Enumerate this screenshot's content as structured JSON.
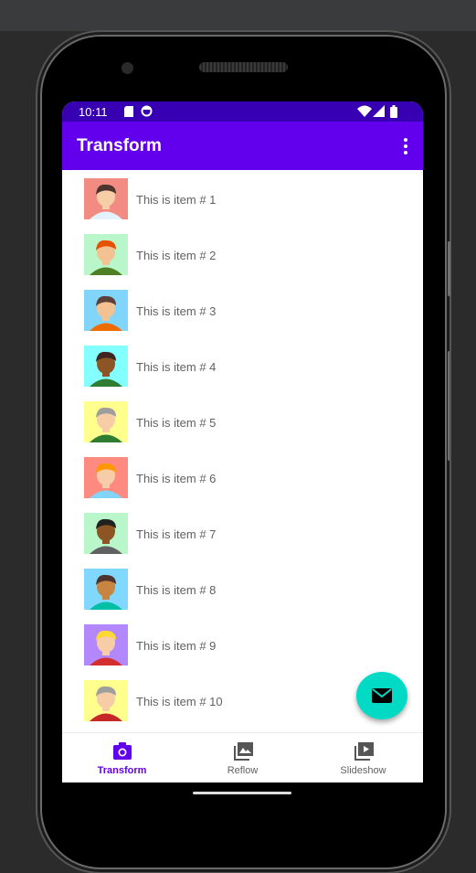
{
  "status_bar": {
    "time": "10:11"
  },
  "app_bar": {
    "title": "Transform"
  },
  "list": {
    "items": [
      {
        "label": "This is item # 1",
        "bg": "#f28b82",
        "skin": "#f7cda8",
        "hair": "#4e342e",
        "shirt": "#e3f2fd"
      },
      {
        "label": "This is item # 2",
        "bg": "#b9f6ca",
        "skin": "#f4c292",
        "hair": "#e65100",
        "shirt": "#4e7f24"
      },
      {
        "label": "This is item # 3",
        "bg": "#81d4fa",
        "skin": "#f4c292",
        "hair": "#5d4037",
        "shirt": "#ef6c00"
      },
      {
        "label": "This is item # 4",
        "bg": "#84ffff",
        "skin": "#8d5524",
        "hair": "#3e2723",
        "shirt": "#2e7d32"
      },
      {
        "label": "This is item # 5",
        "bg": "#ffff8d",
        "skin": "#f7cda8",
        "hair": "#9e9e9e",
        "shirt": "#2e7d32"
      },
      {
        "label": "This is item # 6",
        "bg": "#ff8a80",
        "skin": "#f7cda8",
        "hair": "#ff9800",
        "shirt": "#81d4fa"
      },
      {
        "label": "This is item # 7",
        "bg": "#b9f6ca",
        "skin": "#8d5524",
        "hair": "#212121",
        "shirt": "#616161"
      },
      {
        "label": "This is item # 8",
        "bg": "#80d8ff",
        "skin": "#c68642",
        "hair": "#4e342e",
        "shirt": "#00bfa5"
      },
      {
        "label": "This is item # 9",
        "bg": "#b388ff",
        "skin": "#f7cda8",
        "hair": "#fdd835",
        "shirt": "#d32f2f"
      },
      {
        "label": "This is item # 10",
        "bg": "#ffff8d",
        "skin": "#f7cda8",
        "hair": "#9e9e9e",
        "shirt": "#c62828"
      }
    ]
  },
  "bottom_nav": {
    "items": [
      {
        "label": "Transform",
        "icon": "camera-icon",
        "active": true
      },
      {
        "label": "Reflow",
        "icon": "image-icon",
        "active": false
      },
      {
        "label": "Slideshow",
        "icon": "slideshow-icon",
        "active": false
      }
    ]
  },
  "colors": {
    "primary": "#6200ee",
    "primary_dark": "#3700b3",
    "accent": "#03dac5"
  },
  "fab": {
    "icon": "email-icon"
  }
}
